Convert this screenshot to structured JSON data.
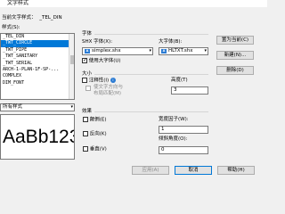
{
  "window": {
    "title": "文字样式"
  },
  "current_style": {
    "label": "当前文字样式：",
    "value": "_TEL_DIN"
  },
  "styles": {
    "label": "样式(S):",
    "items": [
      {
        "name": "_TEL_DIN",
        "selected": false
      },
      {
        "name": "_TWT_CIRCLE",
        "selected": true
      },
      {
        "name": "_TWT_PIPE",
        "selected": false
      },
      {
        "name": "_TWT_SANITARY",
        "selected": false
      },
      {
        "name": "_TWT_SERIAL",
        "selected": false
      },
      {
        "name": "ARCH-1-PLAN-1F-SP-...",
        "selected": false
      },
      {
        "name": "COMPLEX",
        "selected": false
      },
      {
        "name": "DIM_FONT",
        "selected": false
      }
    ],
    "filter_value": "所有样式"
  },
  "preview": {
    "text": "AaBb123"
  },
  "font": {
    "group_label": "字体",
    "shx_label": "SHX 字体(X):",
    "shx_value": "simplex.shx",
    "bigfont_label": "大字体(B):",
    "bigfont_value": "HLTXT.shx",
    "use_bigfont_label": "使用大字体(U)",
    "use_bigfont_checked": true,
    "shx_icon": "A",
    "bigfont_icon": "A"
  },
  "size": {
    "group_label": "大小",
    "annotative_label": "注释性(I)",
    "annotative_checked": false,
    "match_orientation_label": "使文字方向与布局匹配(M)",
    "match_orientation_checked": false,
    "height_label": "高度(T)",
    "height_value": "3"
  },
  "effects": {
    "group_label": "效果",
    "upside_down_label": "颠倒(E)",
    "upside_down_checked": false,
    "backwards_label": "反向(K)",
    "backwards_checked": false,
    "vertical_label": "垂直(V)",
    "vertical_checked": false,
    "width_factor_label": "宽度因子(W):",
    "width_factor_value": "1",
    "oblique_label": "倾斜角度(O):",
    "oblique_value": "0"
  },
  "buttons": {
    "set_current": "置为当前(C)",
    "new": "新建(N)...",
    "delete": "删除(D)",
    "apply": "应用(A)",
    "cancel": "取消",
    "help": "帮助(H)"
  },
  "colors": {
    "selection": "#0078d7",
    "button_bg": "#e1e1e1",
    "dialog_bg": "#f0f0f0"
  }
}
